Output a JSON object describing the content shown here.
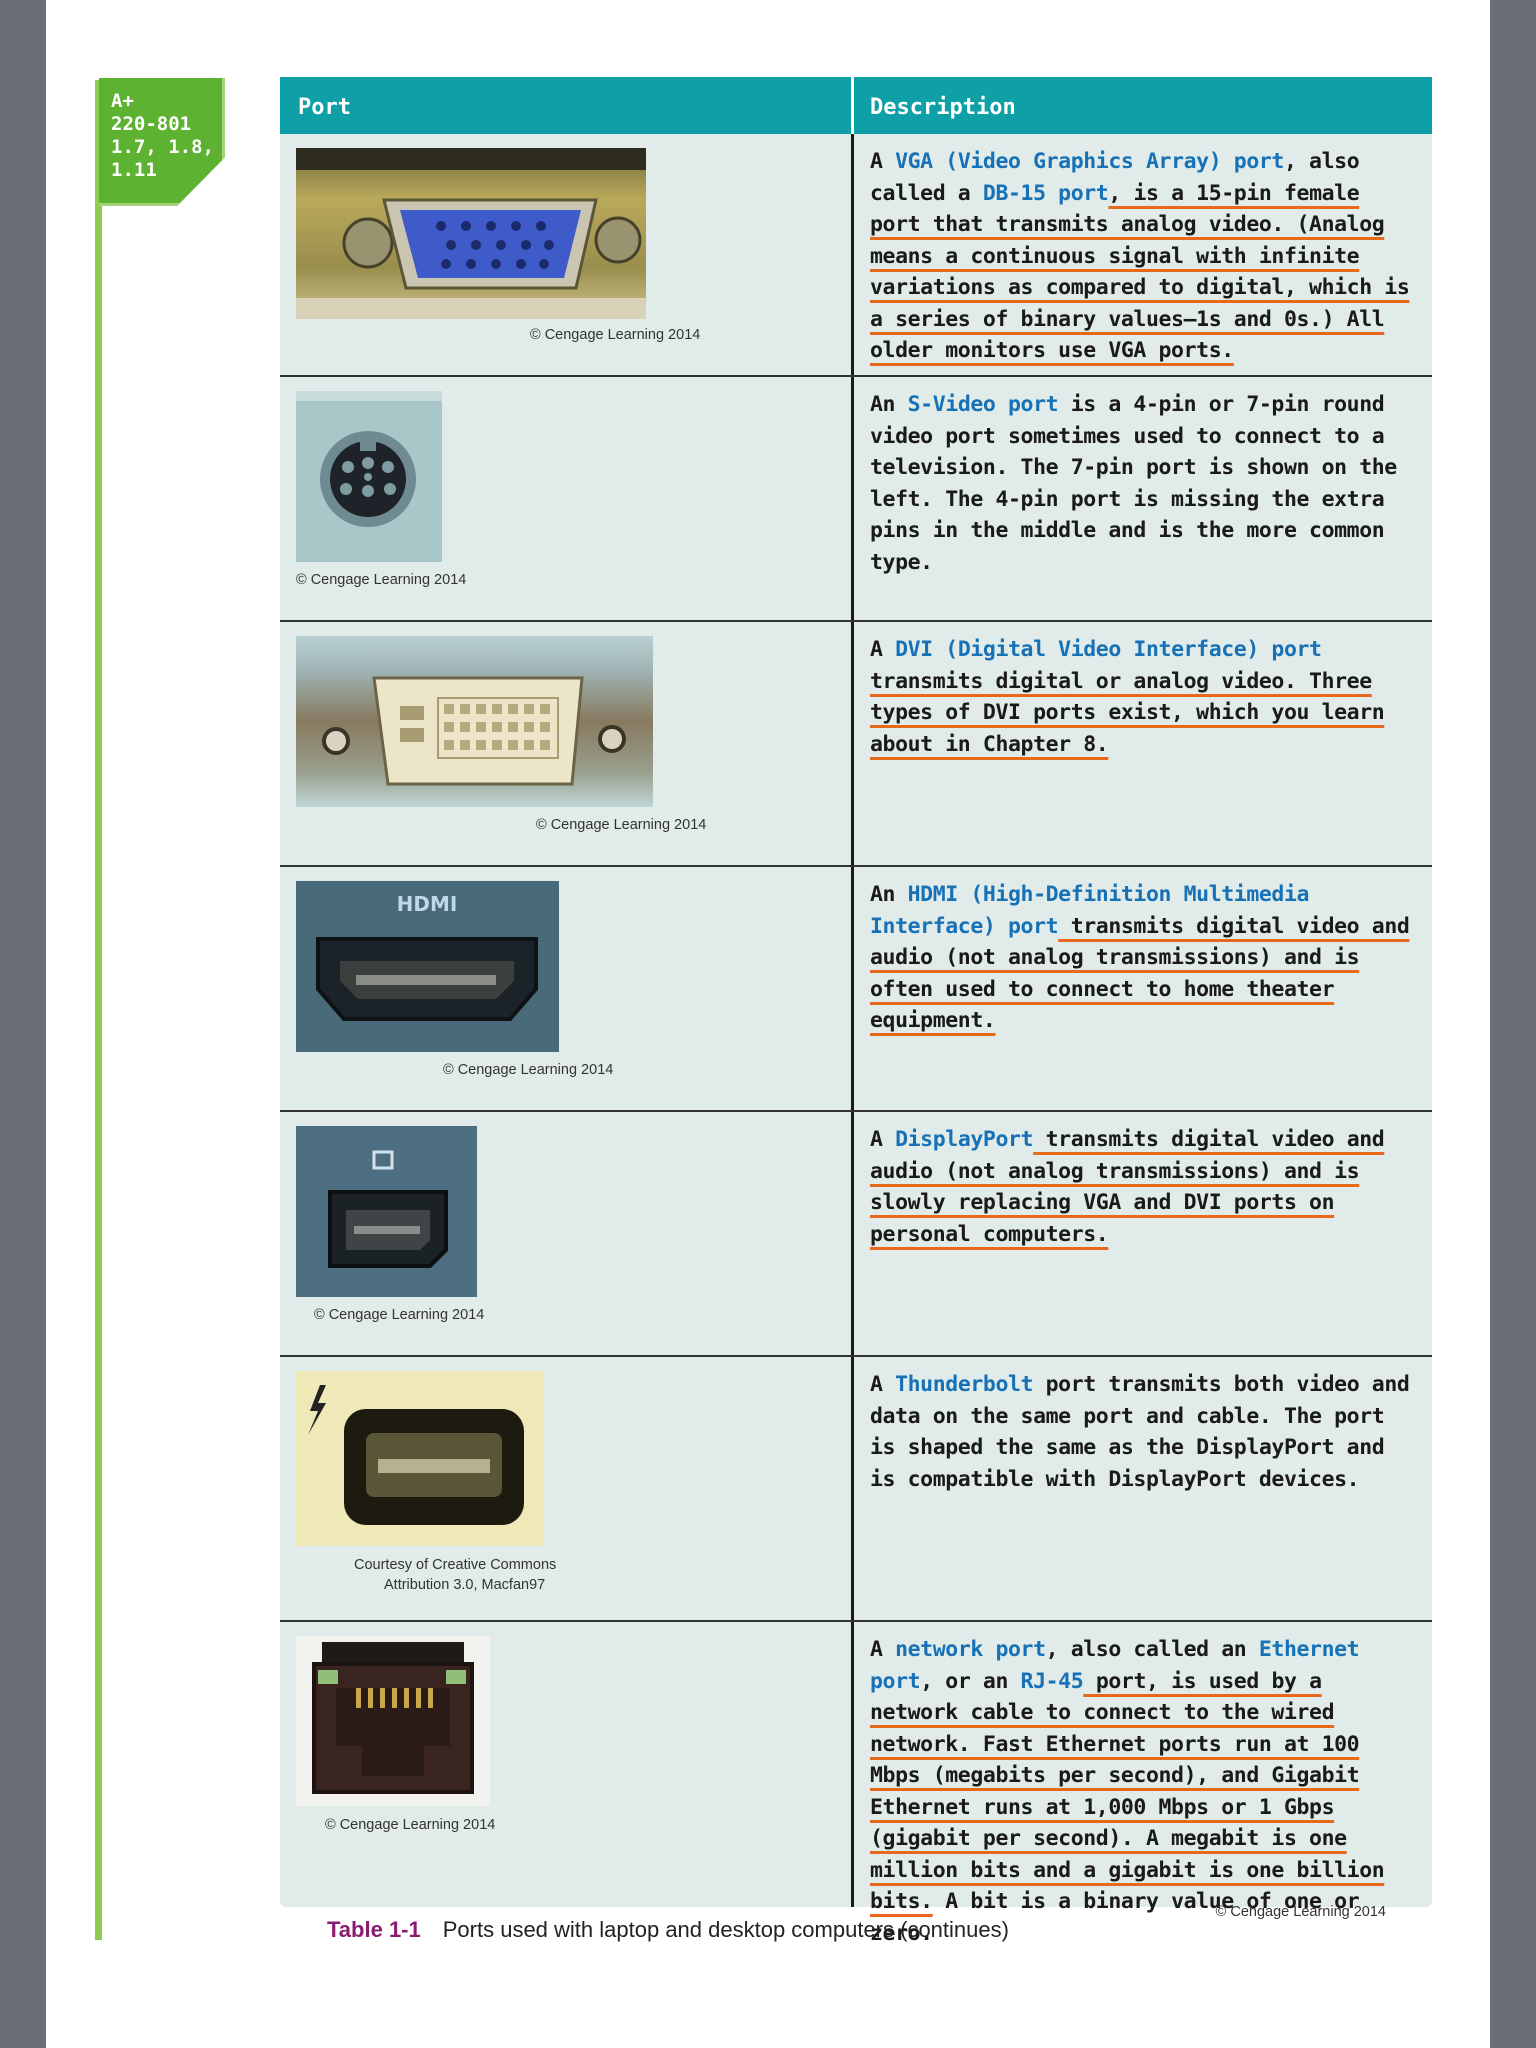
{
  "exam_badge": {
    "lines": [
      "A+",
      "220-801",
      "1.7, 1.8,",
      "1.11"
    ]
  },
  "table": {
    "headers": {
      "port": "Port",
      "description": "Description"
    },
    "rows": [
      {
        "credit": "© Cengage Learning 2014",
        "image_icon": "vga-port-icon",
        "desc": [
          {
            "t": "A "
          },
          {
            "t": "VGA (Video Graphics Array) port",
            "term": true
          },
          {
            "t": ", also called a "
          },
          {
            "t": "DB-15 port",
            "term": true
          },
          {
            "t": ", is a 15-pin female port that transmits analog video. (Analog means a continuous signal with infinite variations as compared to digital, which is a series of binary values—1s and 0s.) All older monitors use VGA ports.",
            "ul": true
          }
        ]
      },
      {
        "credit": "© Cengage Learning 2014",
        "image_icon": "s-video-port-icon",
        "desc": [
          {
            "t": "An "
          },
          {
            "t": "S-Video port",
            "term": true
          },
          {
            "t": " is a 4-pin or 7-pin round video port sometimes used to connect to a television. The 7-pin port is shown on the left. The 4-pin port is missing the extra pins in the middle and is the more common type."
          }
        ]
      },
      {
        "credit": "© Cengage Learning 2014",
        "image_icon": "dvi-port-icon",
        "desc": [
          {
            "t": "A "
          },
          {
            "t": "DVI (Digital Video Interface) port",
            "term": true
          },
          {
            "t": " transmits digital or analog video. Three types of DVI ports exist, which you learn about in Chapter 8.",
            "ul": true
          }
        ]
      },
      {
        "credit": "© Cengage Learning 2014",
        "image_icon": "hdmi-port-icon",
        "image_text": "HDMI",
        "desc": [
          {
            "t": "An "
          },
          {
            "t": "HDMI (High-Definition Multimedia Interface) port",
            "term": true
          },
          {
            "t": " transmits digital video and audio (not analog transmissions) and is often used to connect to home theater equipment.",
            "ul": true
          }
        ]
      },
      {
        "credit": "© Cengage Learning 2014",
        "image_icon": "displayport-port-icon",
        "desc": [
          {
            "t": "A "
          },
          {
            "t": "DisplayPort",
            "term": true
          },
          {
            "t": " transmits digital video and audio (not analog transmissions) and is slowly replacing VGA and DVI ports on personal computers.",
            "ul": true
          }
        ]
      },
      {
        "credit_lines": [
          "Courtesy of Creative Commons",
          "Attribution 3.0, Macfan97"
        ],
        "image_icon": "thunderbolt-port-icon",
        "desc": [
          {
            "t": "A "
          },
          {
            "t": "Thunderbolt",
            "term": true
          },
          {
            "t": " port transmits both video and data on the same port and cable. The port is shaped the same as the DisplayPort and is compatible with DisplayPort devices."
          }
        ]
      },
      {
        "credit": "© Cengage Learning 2014",
        "image_icon": "network-port-icon",
        "desc": [
          {
            "t": "A "
          },
          {
            "t": "network port",
            "term": true
          },
          {
            "t": ", also called an "
          },
          {
            "t": "Ethernet port",
            "term": true
          },
          {
            "t": ", or an "
          },
          {
            "t": "RJ-45",
            "term": true
          },
          {
            "t": " port, is used by a network cable to connect to the wired network. Fast Ethernet ports run at 100 Mbps (megabits per second), and Gigabit Ethernet runs at 1,000 Mbps or 1 Gbps (gigabit per second). A megabit is one million bits and a gigabit is one billion bits.",
            "ul": true
          },
          {
            "t": " A bit is a binary value of one or zero."
          }
        ]
      }
    ]
  },
  "table_credit": "© Cengage Learning 2014",
  "caption": {
    "number": "Table 1-1",
    "text": "Ports used with laptop and desktop computers (continues)"
  }
}
